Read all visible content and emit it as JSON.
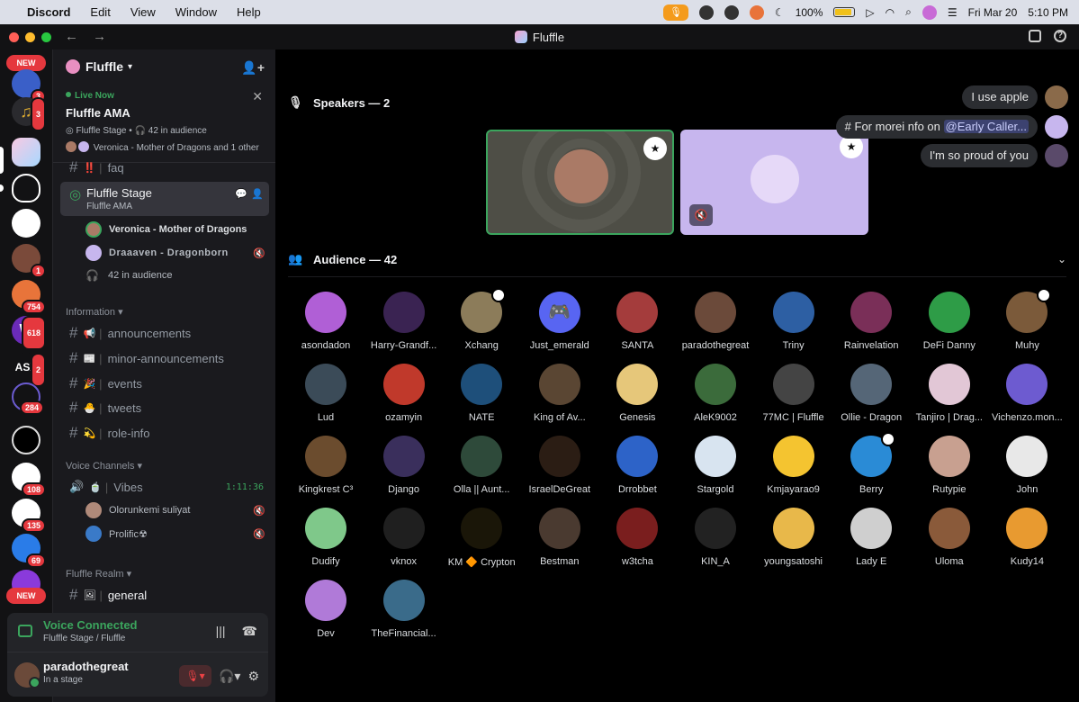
{
  "menubar": {
    "apple": "",
    "app": "Discord",
    "items": [
      "Edit",
      "View",
      "Window",
      "Help"
    ],
    "battery": "100%",
    "date": "Fri Mar 20",
    "time": "5:10 PM"
  },
  "window": {
    "title": "Fluffle"
  },
  "servers": {
    "new_label": "NEW",
    "badges": [
      "3",
      "3",
      "1",
      "754",
      "618",
      "2",
      "284",
      "108",
      "135",
      "69"
    ]
  },
  "guild": {
    "name": "Fluffle"
  },
  "live": {
    "status": "Live Now",
    "title": "Fluffle AMA",
    "stage": "Fluffle Stage",
    "audience": "42 in audience",
    "speakers": "Veronica - Mother of Dragons and 1 other"
  },
  "channels": {
    "faq": "faq",
    "stage_name": "Fluffle Stage",
    "stage_topic": "Fluffle AMA",
    "stage_users": [
      "Veronica - Mother of Dragons",
      "Draaaven - Dragonborn"
    ],
    "stage_audience": "42 in audience",
    "info_category": "Information",
    "info_channels": [
      "announcements",
      "minor-announcements",
      "events",
      "tweets",
      "role-info"
    ],
    "voice_category": "Voice Channels",
    "vibes": "Vibes",
    "vibes_timer": "1:11:36",
    "vibes_users": [
      "Olorunkemi suliyat",
      "Prolific☢"
    ],
    "realm_category": "Fluffle Realm",
    "general": "general"
  },
  "voice_panel": {
    "title": "Voice Connected",
    "sub": "Fluffle Stage / Fluffle",
    "username": "paradothegreat",
    "status": "In a stage"
  },
  "stage": {
    "speakers_label": "Speakers — 2",
    "audience_label": "Audience — 42"
  },
  "chat": [
    {
      "text": "I use apple"
    },
    {
      "prefix": "# For morei nfo on ",
      "mention": "@Early Caller..."
    },
    {
      "text": "I'm so proud of you"
    }
  ],
  "audience": [
    {
      "name": "asondadon",
      "color": "#b05fd6"
    },
    {
      "name": "Harry-Grandf...",
      "color": "#3a2352"
    },
    {
      "name": "Xchang",
      "color": "#8c7c5a",
      "mod": true
    },
    {
      "name": "Just_emerald",
      "color": "#5865f2",
      "discord": true
    },
    {
      "name": "SANTA",
      "color": "#a43c3c"
    },
    {
      "name": "paradothegreat",
      "color": "#6b4a3a"
    },
    {
      "name": "Triny",
      "color": "#2d5fa3"
    },
    {
      "name": "Rainvelation",
      "color": "#7a2f58"
    },
    {
      "name": "DeFi Danny",
      "color": "#2e9c47"
    },
    {
      "name": "Muhy",
      "color": "#7b5a3a",
      "mod": true
    },
    {
      "name": "Lud",
      "color": "#3b4b58"
    },
    {
      "name": "ozamyin",
      "color": "#c0392b"
    },
    {
      "name": "NATE",
      "color": "#1e4f7a"
    },
    {
      "name": "King of Av...",
      "color": "#5a4633"
    },
    {
      "name": "Genesis",
      "color": "#e6c77a"
    },
    {
      "name": "AleK9002",
      "color": "#3b6b3b"
    },
    {
      "name": "77MC | Fluffle",
      "color": "#444"
    },
    {
      "name": "Ollie - Dragon",
      "color": "#556677"
    },
    {
      "name": "Tanjiro | Drag...",
      "color": "#e2c7d6"
    },
    {
      "name": "Vichenzo.mon...",
      "color": "#6d5bd0"
    },
    {
      "name": "Kingkrest C³",
      "color": "#6b4c2e"
    },
    {
      "name": "Django",
      "color": "#3a2f5c"
    },
    {
      "name": "Olla || Aunt...",
      "color": "#2e4a3a"
    },
    {
      "name": "IsraelDeGreat",
      "color": "#2b1d14"
    },
    {
      "name": "Drrobbet",
      "color": "#2d63c8"
    },
    {
      "name": "Stargold",
      "color": "#d8e4f0"
    },
    {
      "name": "Kmjayarao9",
      "color": "#f4c430"
    },
    {
      "name": "Berry",
      "color": "#2a8bd6",
      "mod": true
    },
    {
      "name": "Rutypie",
      "color": "#c8a090"
    },
    {
      "name": "John",
      "color": "#e8e8e8"
    },
    {
      "name": "Dudify",
      "color": "#7fc88a"
    },
    {
      "name": "vknox",
      "color": "#1f1f1f"
    },
    {
      "name": "KM 🔶 Crypton",
      "color": "#1a1608"
    },
    {
      "name": "Bestman",
      "color": "#4a3a30"
    },
    {
      "name": "w3tcha",
      "color": "#7a1e1e"
    },
    {
      "name": "KIN_A",
      "color": "#222"
    },
    {
      "name": "youngsatoshi",
      "color": "#e8b84a"
    },
    {
      "name": "Lady E",
      "color": "#cfcfcf"
    },
    {
      "name": "Uloma",
      "color": "#8a5a3a"
    },
    {
      "name": "Kudy14",
      "color": "#e89a30"
    },
    {
      "name": "Dev",
      "color": "#b07ad8"
    },
    {
      "name": "TheFinancial...",
      "color": "#3a6b8a"
    }
  ]
}
